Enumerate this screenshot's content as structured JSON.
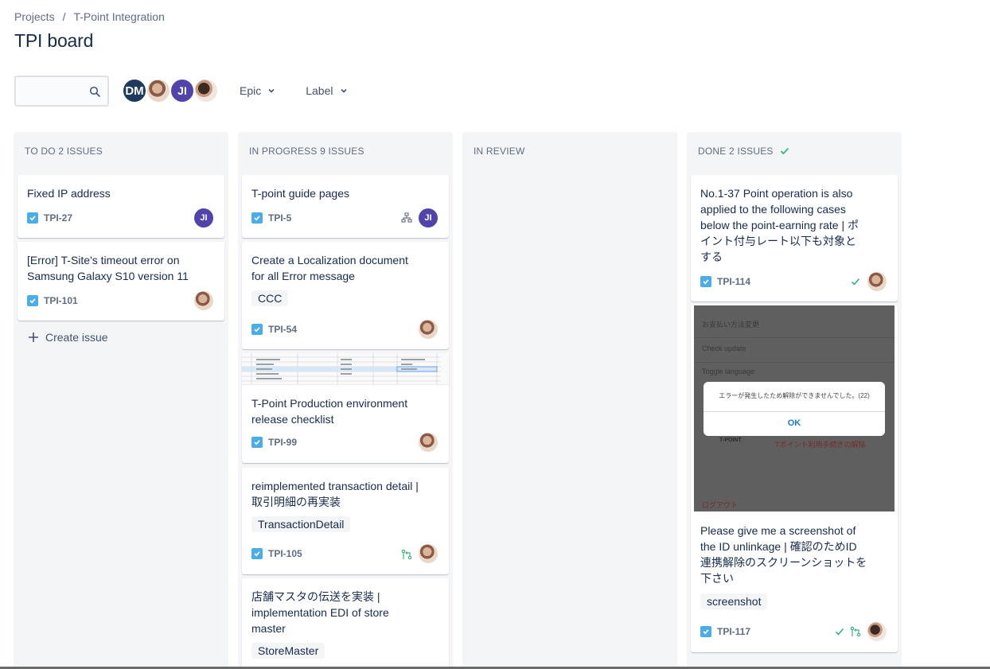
{
  "breadcrumb": {
    "project_root": "Projects",
    "separator": "/",
    "project": "T-Point Integration"
  },
  "page_title": "TPI board",
  "search": {
    "placeholder": "",
    "value": ""
  },
  "avatars": [
    {
      "initials": "DM"
    },
    {
      "initials": ""
    },
    {
      "initials": "JI"
    },
    {
      "initials": ""
    }
  ],
  "filters": {
    "epic": "Epic",
    "label": "Label"
  },
  "columns": {
    "todo": {
      "header": "TO DO 2 ISSUES",
      "cards": [
        {
          "title": "Fixed IP address",
          "key": "TPI-27",
          "assignee": "JI"
        },
        {
          "title": "[Error] T-Site's timeout error on Samsung Galaxy S10 version 11",
          "key": "TPI-101"
        }
      ],
      "create_issue": "Create issue"
    },
    "in_progress": {
      "header": "IN PROGRESS 9 ISSUES",
      "cards": [
        {
          "title": "T-point guide pages",
          "key": "TPI-5",
          "assignee": "JI"
        },
        {
          "title": "Create a Localization document for all Error message",
          "label": "CCC",
          "key": "TPI-54"
        },
        {
          "title": "T-Point Production environment release checklist",
          "key": "TPI-99"
        },
        {
          "title": "reimplemented transaction detail | 取引明細の再実装",
          "label": "TransactionDetail",
          "key": "TPI-105"
        },
        {
          "title": "店舗マスタの伝送を実装 | implementation EDI of store master",
          "label": "StoreMaster"
        }
      ]
    },
    "in_review": {
      "header": "IN REVIEW"
    },
    "done": {
      "header": "DONE 2 ISSUES",
      "cards": [
        {
          "title": "No.1-37 Point operation is also applied to the following cases below the point-earning rate | ポイント付与レート以下も対象とする",
          "key": "TPI-114"
        },
        {
          "title": "Please give me a screenshot of the ID unlinkage | 確認のためID連携解除のスクリーンショットを下さい",
          "label": "screenshot",
          "key": "TPI-117"
        }
      ],
      "screenshot": {
        "rows": [
          "お支払い方法変更",
          "Check update",
          "Toggle language"
        ],
        "dialog_message": "エラーが発生したため解除ができませんでした。(22)",
        "dialog_ok": "OK",
        "brand": "T-POINT",
        "link": "Tポイント利用手続きの解除",
        "logout": "ログアウト"
      }
    }
  },
  "colors": {
    "accent_blue": "#4bade8",
    "ji_avatar": "#5243aa",
    "dm_avatar": "#1e3a5f",
    "done_green": "#36b37e",
    "column_bg": "#f4f5f7"
  }
}
